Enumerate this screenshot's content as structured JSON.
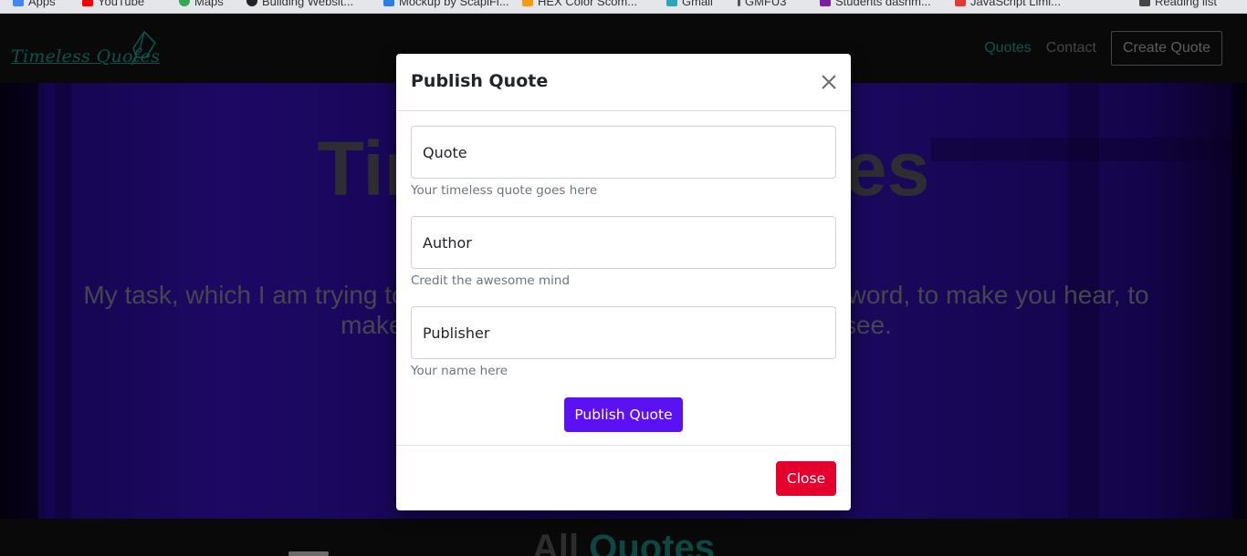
{
  "bookmarks": [
    {
      "label": "Apps",
      "icon": "apps-grid-icon",
      "color": "#4285f4"
    },
    {
      "label": "YouTube",
      "icon": "youtube-icon",
      "color": "#ff0000"
    },
    {
      "label": "Maps",
      "icon": "maps-pin-icon",
      "color": "#34a853"
    },
    {
      "label": "Building Websit...",
      "icon": "github-icon",
      "color": "#222222"
    },
    {
      "label": "Mockup by ScapiFi...",
      "icon": "mockup-icon",
      "color": "#2b7de9"
    },
    {
      "label": "HEX Color Scom...",
      "icon": "hex-icon",
      "color": "#f39c12"
    },
    {
      "label": "Gmail",
      "icon": "gmail-icon",
      "color": "#2aa8b4"
    },
    {
      "label": "GMFU3",
      "icon": "bookmark-icon",
      "color": "#555555"
    },
    {
      "label": "Students dashm...",
      "icon": "students-icon",
      "color": "#7b1fa2"
    },
    {
      "label": "JavaScript Limi...",
      "icon": "javascript-icon",
      "color": "#e53935"
    },
    {
      "label": "Reading list",
      "icon": "reading-list-icon",
      "color": "#444444"
    }
  ],
  "navbar": {
    "logo_text": "Timeless Quotes",
    "links": [
      {
        "label": "Quotes",
        "active": true
      },
      {
        "label": "Contact",
        "active": false
      }
    ],
    "create_button": "Create Quote"
  },
  "hero": {
    "title": "Timeless Quotes",
    "subtitle": "My task, which I am trying to achieve is, by the power of the written word, to make you hear, to make you feel—it is, before all, to make you see."
  },
  "section": {
    "title_plain": "All",
    "title_accent": "Quotes"
  },
  "modal": {
    "title": "Publish Quote",
    "fields": [
      {
        "placeholder": "Quote",
        "help": "Your timeless quote goes here"
      },
      {
        "placeholder": "Author",
        "help": "Credit the awesome mind"
      },
      {
        "placeholder": "Publisher",
        "help": "Your name here"
      }
    ],
    "submit_label": "Publish Quote",
    "close_label": "Close"
  },
  "colors": {
    "accent": "#1aa99d",
    "publish_button": "#5c11f5",
    "close_button": "#e6002e",
    "hero_purple": "#3a12c8"
  }
}
